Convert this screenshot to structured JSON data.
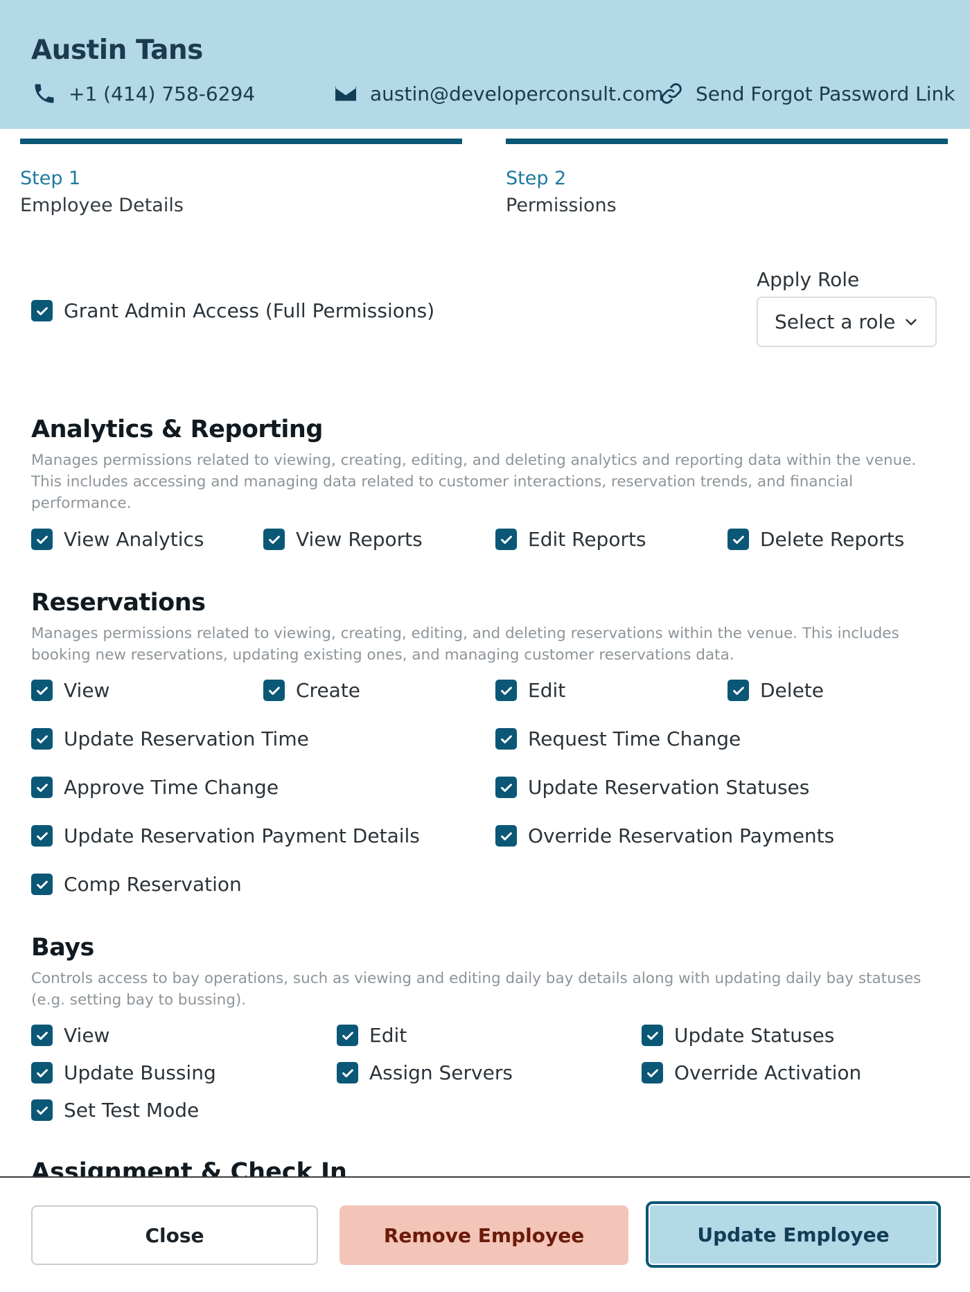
{
  "employee": {
    "name": "Austin Tans",
    "phone": "+1 (414) 758-6294",
    "email": "austin@developerconsult.com",
    "forgot_password_link": "Send Forgot Password Link"
  },
  "steps": [
    {
      "number": "Step 1",
      "title": "Employee Details"
    },
    {
      "number": "Step 2",
      "title": "Permissions"
    }
  ],
  "admin_access": {
    "label": "Grant Admin Access (Full Permissions)",
    "checked": true
  },
  "apply_role": {
    "label": "Apply Role",
    "value": "Select a role"
  },
  "sections": {
    "analytics": {
      "title": "Analytics & Reporting",
      "description_lines": [
        "Manages permissions related to viewing, creating, editing, and deleting analytics and reporting data within the venue.",
        "This includes accessing and managing data related to customer interactions, reservation trends, and financial",
        "performance."
      ],
      "permissions": [
        "View Analytics",
        "View Reports",
        "Edit Reports",
        "Delete Reports"
      ]
    },
    "reservations": {
      "title": "Reservations",
      "description_lines": [
        "Manages permissions related to viewing, creating, editing, and deleting reservations within the venue. This includes",
        "booking new reservations, updating existing ones, and managing customer reservations data."
      ],
      "permissions": [
        "View",
        "Create",
        "Edit",
        "Delete",
        "Update Reservation Time",
        "Request Time Change",
        "Approve Time Change",
        "Update Reservation Statuses",
        "Update Reservation Payment Details",
        "Override Reservation Payments",
        "Comp Reservation"
      ]
    },
    "bays": {
      "title": "Bays",
      "description_lines": [
        "Controls access to bay operations, such as viewing and editing daily bay details along with updating daily bay statuses",
        "(e.g. setting bay to bussing)."
      ],
      "permissions": [
        "View",
        "Edit",
        "Update Statuses",
        "Update Bussing",
        "Assign Servers",
        "Override Activation",
        "Set Test Mode"
      ]
    },
    "assignment": {
      "title": "Assignment & Check In"
    }
  },
  "buttons": {
    "close": "Close",
    "remove": "Remove Employee",
    "update": "Update Employee"
  },
  "colors": {
    "header_bg": "#b3d8e6",
    "accent": "#0b5776",
    "remove_bg": "#f3c4b8"
  }
}
